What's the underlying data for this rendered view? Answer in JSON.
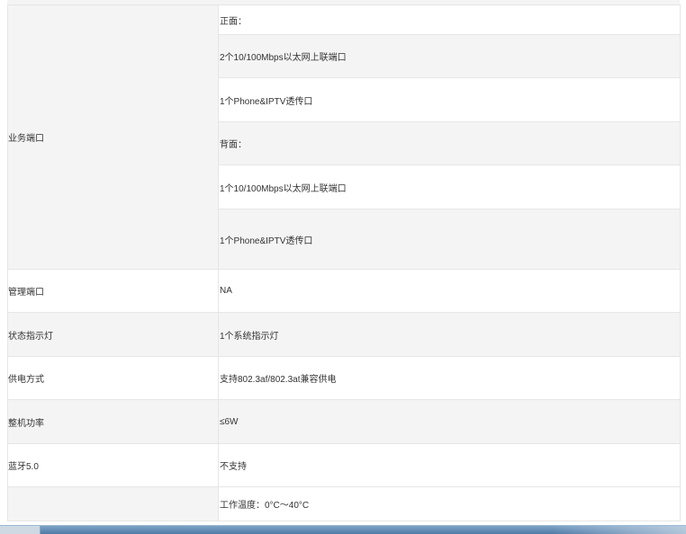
{
  "spec": {
    "ports": {
      "label": "业务端口",
      "front_title": "正面：",
      "front_uplink": "2个10/100Mbps以太网上联端口",
      "front_phone": "1个Phone&IPTV透传口",
      "back_title": "背面：",
      "back_uplink": "1个10/100Mbps以太网上联端口",
      "back_phone": "1个Phone&IPTV透传口"
    },
    "mgmt": {
      "label": "管理端口",
      "value": "NA"
    },
    "led": {
      "label": "状态指示灯",
      "value": "1个系统指示灯"
    },
    "power": {
      "label": "供电方式",
      "value": "支持802.3af/802.3at兼容供电"
    },
    "consumption": {
      "label": "整机功率",
      "value": "≤6W"
    },
    "bluetooth": {
      "label": "蓝牙5.0",
      "value": "不支持"
    },
    "env": {
      "label": "",
      "temp": "工作温度：0°C～40°C"
    }
  }
}
